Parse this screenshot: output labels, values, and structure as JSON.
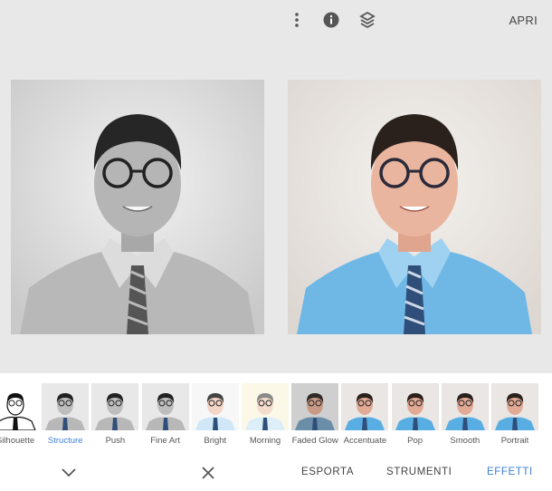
{
  "header": {
    "open_label": "APRI",
    "icons": [
      "more-vert-icon",
      "info-icon",
      "layers-icon"
    ]
  },
  "filters": [
    {
      "label": "Portrait",
      "tone": "color"
    },
    {
      "label": "Smooth",
      "tone": "color"
    },
    {
      "label": "Pop",
      "tone": "color"
    },
    {
      "label": "Accentuate",
      "tone": "color"
    },
    {
      "label": "Faded Glow",
      "tone": "faded"
    },
    {
      "label": "Morning",
      "tone": "morning"
    },
    {
      "label": "Bright",
      "tone": "bright"
    },
    {
      "label": "Fine Art",
      "tone": "bw"
    },
    {
      "label": "Push",
      "tone": "bw"
    },
    {
      "label": "Structure",
      "tone": "bw",
      "active": true
    },
    {
      "label": "Silhouette",
      "tone": "silhouette"
    }
  ],
  "bottom": {
    "tabs": [
      "EFFETTI",
      "STRUMENTI",
      "ESPORTA"
    ],
    "active_tab": "EFFETTI",
    "colors": {
      "accent": "#3b7fd6",
      "text": "#444444",
      "background": "#e8e8e8"
    }
  }
}
